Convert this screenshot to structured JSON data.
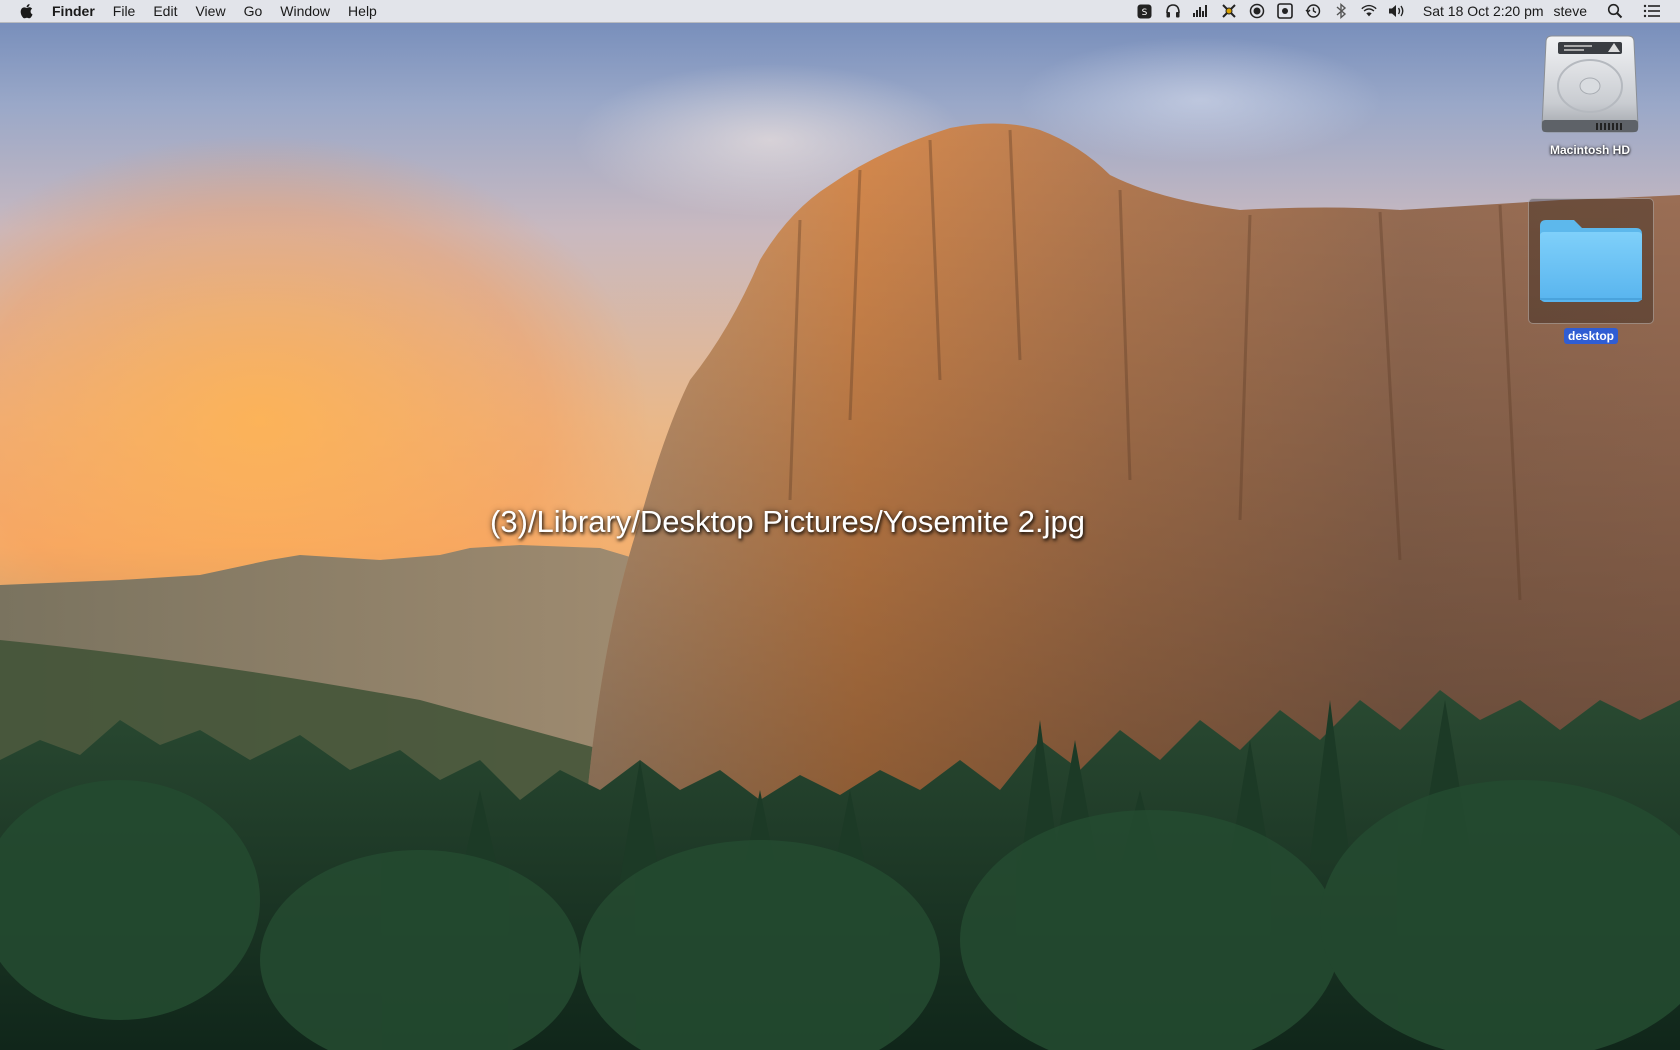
{
  "menubar": {
    "apple_icon": "apple-logo-icon",
    "app_name": "Finder",
    "menus": [
      "File",
      "Edit",
      "View",
      "Go",
      "Window",
      "Help"
    ],
    "status_icons": [
      "app-status-icon",
      "headphones-icon",
      "cpu-meter-icon",
      "network-activity-icon",
      "target-icon",
      "record-icon",
      "time-machine-icon",
      "bluetooth-icon",
      "wifi-icon",
      "volume-icon"
    ],
    "clock": "Sat 18 Oct  2:20 pm",
    "user": "steve",
    "spotlight_icon": "search-icon",
    "notification_icon": "list-icon"
  },
  "desktop": {
    "icons": [
      {
        "label": "Macintosh HD",
        "icon": "hard-drive-icon",
        "selected": false
      },
      {
        "label": "desktop",
        "icon": "folder-icon",
        "selected": true
      }
    ],
    "overlay_text": "(3)/Library/Desktop Pictures/Yosemite 2.jpg"
  },
  "colors": {
    "menubar_bg": "#ececee",
    "selection_blue": "#2f5dd3",
    "folder_blue": "#6cc3f3"
  }
}
